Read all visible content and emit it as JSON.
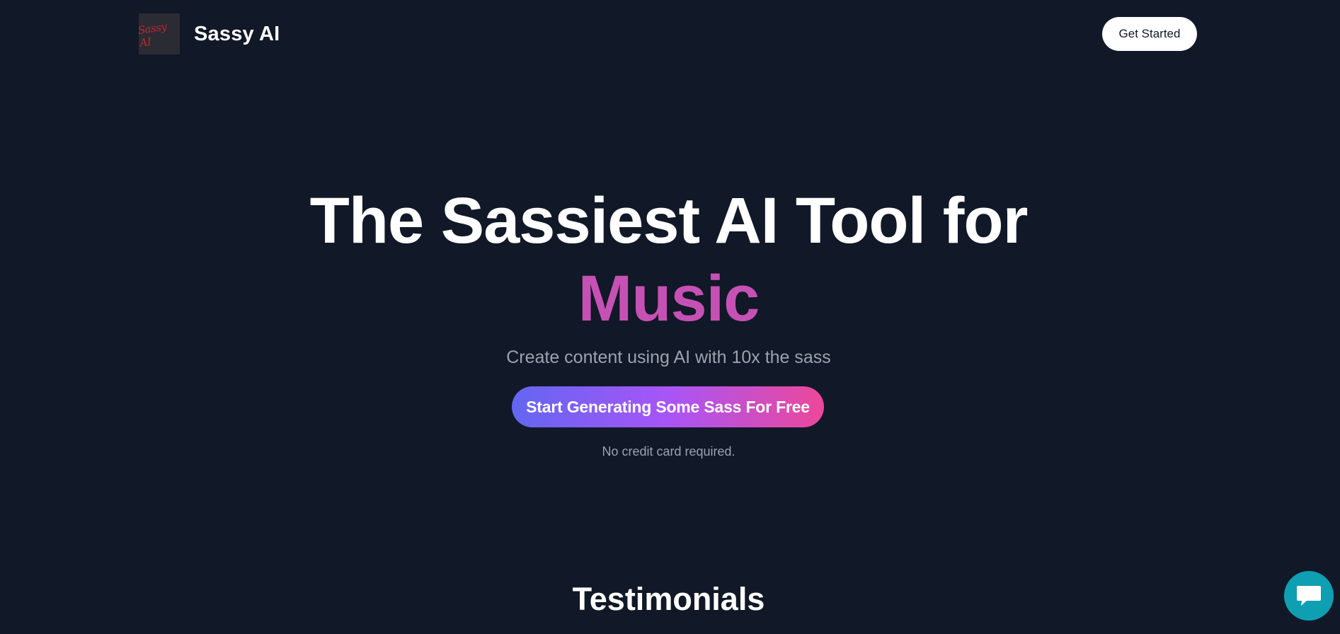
{
  "header": {
    "logo_text": "Sassy AI",
    "brand_name": "Sassy AI",
    "get_started_label": "Get Started"
  },
  "hero": {
    "title_line1": "The Sassiest AI Tool for",
    "title_highlight": "Music",
    "subtitle": "Create content using AI with 10x the sass",
    "cta_label": "Start Generating Some Sass For Free",
    "note": "No credit card required."
  },
  "testimonials": {
    "heading": "Testimonials"
  },
  "chat": {
    "icon": "chat-bubble-icon"
  },
  "colors": {
    "background": "#111827",
    "highlight": "#c651b4",
    "cta_gradient_start": "#6366f1",
    "cta_gradient_mid": "#a855f7",
    "cta_gradient_end": "#ec4899",
    "chat_button": "#0e9fb3"
  }
}
